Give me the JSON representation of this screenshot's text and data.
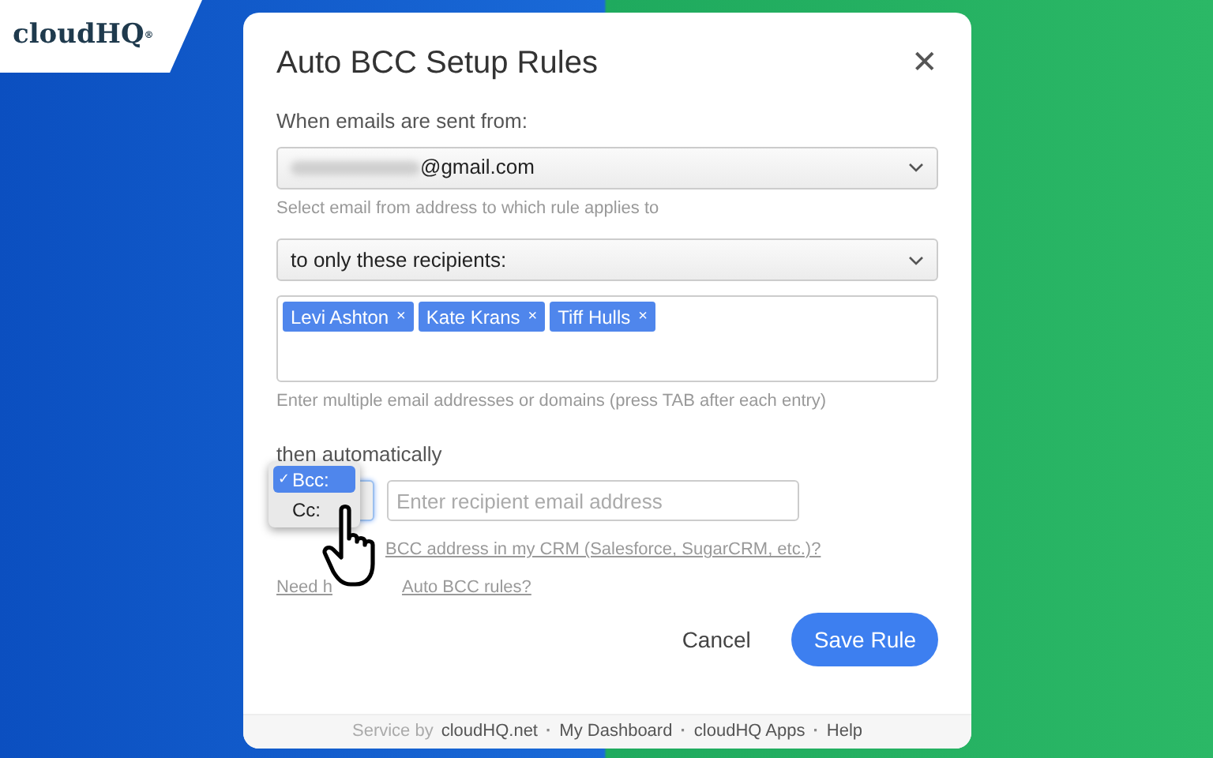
{
  "logo": "cloudHQ",
  "logo_mark": "®",
  "dialog": {
    "title": "Auto BCC Setup Rules",
    "close": "✕",
    "from_label": "When emails are sent from:",
    "from_select": {
      "value": "@gmail.com",
      "hint": "Select email from address to which rule applies to"
    },
    "recipients_select": {
      "value": "to only these recipients:"
    },
    "tags": [
      {
        "label": "Levi Ashton",
        "remove": "×"
      },
      {
        "label": "Kate Krans",
        "remove": "×"
      },
      {
        "label": "Tiff Hulls",
        "remove": "×"
      }
    ],
    "tags_hint": "Enter multiple email addresses or domains (press TAB after each entry)",
    "action_label": "then automatically",
    "mode_options": [
      {
        "label": "Bcc:",
        "check": "✓",
        "selected": true
      },
      {
        "label": "Cc:",
        "selected": false
      }
    ],
    "recipient_input": {
      "placeholder": "Enter recipient email address"
    },
    "links": [
      {
        "parts": [
          "BCC address in my CRM (Salesforce, SugarCRM, etc.)?"
        ]
      },
      {
        "parts": [
          "Need h",
          "Auto BCC rules?"
        ]
      }
    ],
    "buttons": [
      {
        "label": "Cancel",
        "kind": "secondary"
      },
      {
        "label": "Save Rule",
        "kind": "primary"
      }
    ],
    "footer": [
      {
        "label": "Service by",
        "kind": "text"
      },
      {
        "label": "cloudHQ.net",
        "kind": "link"
      },
      {
        "label": "·",
        "kind": "sep"
      },
      {
        "label": "My Dashboard",
        "kind": "link"
      },
      {
        "label": "·",
        "kind": "sep"
      },
      {
        "label": "cloudHQ Apps",
        "kind": "link"
      },
      {
        "label": "·",
        "kind": "sep"
      },
      {
        "label": "Help",
        "kind": "link"
      }
    ]
  }
}
